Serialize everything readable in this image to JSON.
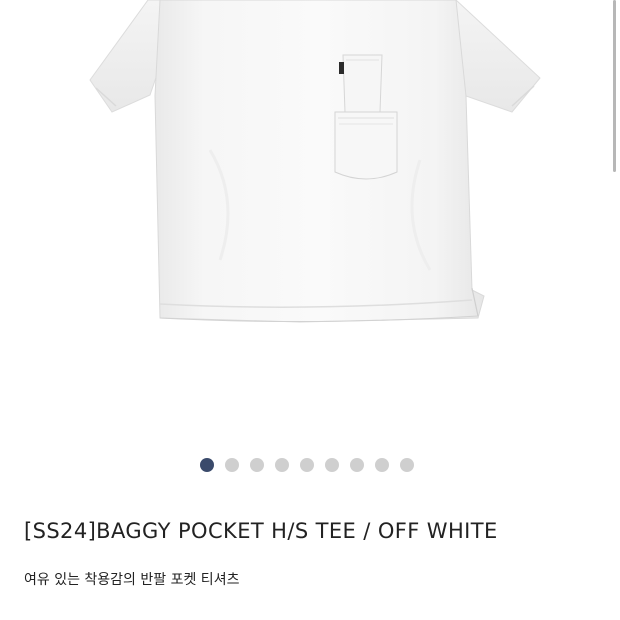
{
  "product": {
    "title": "[SS24]BAGGY POCKET H/S TEE / OFF WHITE",
    "subtitle": "여유 있는 착용감의 반팔 포켓 티셔츠",
    "image_icon": "white-pocket-tshirt"
  },
  "carousel": {
    "total": 9,
    "active_index": 0,
    "active_color": "#3a4a6b",
    "inactive_color": "#cfcfcf"
  }
}
